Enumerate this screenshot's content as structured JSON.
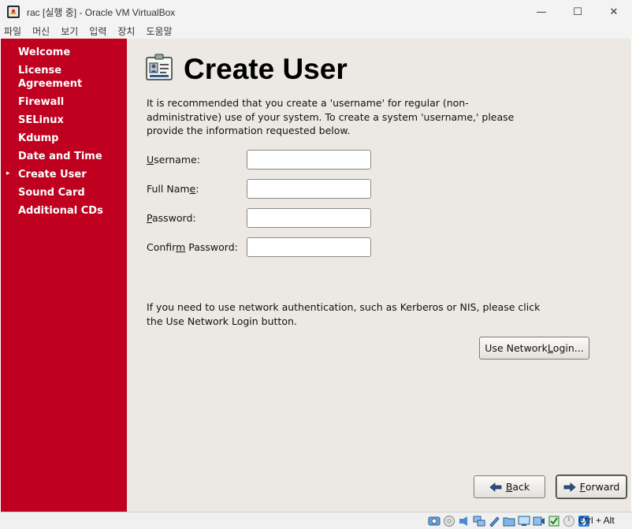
{
  "window": {
    "title": "rac [실행 중] - Oracle VM VirtualBox",
    "minimize_glyph": "—",
    "maximize_glyph": "☐",
    "close_glyph": "✕"
  },
  "menubar": {
    "items": [
      "파일",
      "머신",
      "보기",
      "입력",
      "장치",
      "도움말"
    ]
  },
  "sidebar": {
    "current_marker": "▸",
    "items": [
      {
        "label": "Welcome"
      },
      {
        "label": "License Agreement"
      },
      {
        "label": "Firewall"
      },
      {
        "label": "SELinux"
      },
      {
        "label": "Kdump"
      },
      {
        "label": "Date and Time"
      },
      {
        "label": "Create User"
      },
      {
        "label": "Sound Card"
      },
      {
        "label": "Additional CDs"
      }
    ]
  },
  "main": {
    "title": "Create User",
    "title_icon": "id-badge-icon",
    "description": "It is recommended that you create a 'username' for regular (non-administrative) use of your system. To create a system 'username,' please provide the information requested below.",
    "fields": {
      "username": {
        "pre": "",
        "mn": "U",
        "post": "sername:",
        "value": ""
      },
      "fullname": {
        "pre": "Full Nam",
        "mn": "e",
        "post": ":",
        "value": ""
      },
      "password": {
        "pre": "",
        "mn": "P",
        "post": "assword:",
        "value": ""
      },
      "confirm": {
        "pre": "Confir",
        "mn": "m",
        "post": " Password:",
        "value": ""
      }
    },
    "network_text": "If you need to use network authentication, such as Kerberos or NIS, please click the Use Network Login button.",
    "network_button": {
      "pre": "Use Network ",
      "mn": "L",
      "post": "ogin..."
    }
  },
  "footer": {
    "back": {
      "pre": "",
      "mn": "B",
      "post": "ack",
      "icon": "arrow-left-icon"
    },
    "forward": {
      "pre": "",
      "mn": "F",
      "post": "orward",
      "icon": "arrow-right-icon"
    }
  },
  "statusbar": {
    "host_key": "Ctrl + Alt",
    "icons": [
      "hard-disk-icon",
      "optical-drive-icon",
      "audio-icon",
      "network-icon",
      "usb-icon",
      "shared-folder-icon",
      "display-icon",
      "video-capture-icon",
      "cpu-icon",
      "mouse-integration-icon",
      "keyboard-icon"
    ]
  },
  "colors": {
    "sidebar_bg": "#c0001f",
    "content_bg": "#ece9e4",
    "host_chrome": "#f3f3f3"
  }
}
